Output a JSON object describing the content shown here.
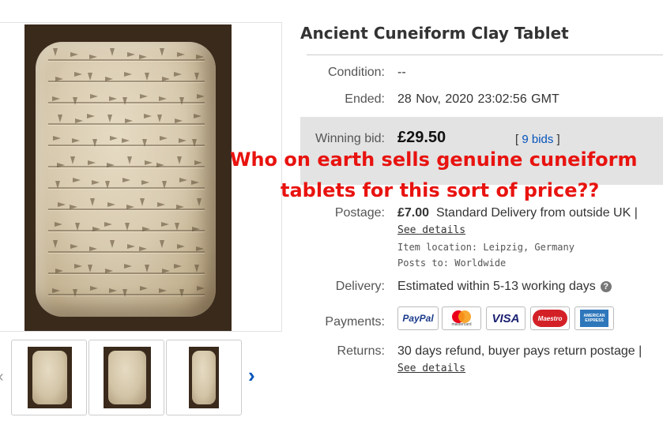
{
  "listing": {
    "title": "Ancient Cuneiform Clay Tablet",
    "condition_label": "Condition:",
    "condition_value": "--",
    "ended_label": "Ended:",
    "ended_value": "28 Nov, 2020  23:02:56 GMT",
    "winning_bid_label": "Winning bid:",
    "winning_bid_value": "£29.50",
    "bids_open": "[",
    "bids_link": "9 bids",
    "bids_close": "]",
    "postage_label": "Postage:",
    "postage_price": "£7.00",
    "postage_desc": "Standard Delivery from outside UK |",
    "postage_see_details": "See details",
    "item_location": "Item location: Leipzig, Germany",
    "posts_to": "Posts to: Worldwide",
    "delivery_label": "Delivery:",
    "delivery_value": "Estimated within 5-13 working days",
    "delivery_help": "?",
    "payments_label": "Payments:",
    "payment_methods": [
      "PayPal",
      "Mastercard",
      "VISA",
      "Maestro",
      "American Express"
    ],
    "paypal_text": "PayPal",
    "mastercard_text": "mastercard",
    "visa_text": "VISA",
    "maestro_text": "Maestro",
    "amex_text": "AMERICAN EXPRESS",
    "returns_label": "Returns:",
    "returns_value": "30 days refund, buyer pays return postage |",
    "returns_see_details": "See details"
  },
  "overlay": {
    "line1": "Who on earth sells genuine cuneiform",
    "line2": "tablets for this sort of price??",
    "color": "#e8130f"
  },
  "gallery": {
    "prev_arrow": "‹",
    "next_arrow": "›",
    "thumbnail_count": 3
  },
  "colors": {
    "link": "#0654ba",
    "bid_box": "#e3e3e3"
  }
}
